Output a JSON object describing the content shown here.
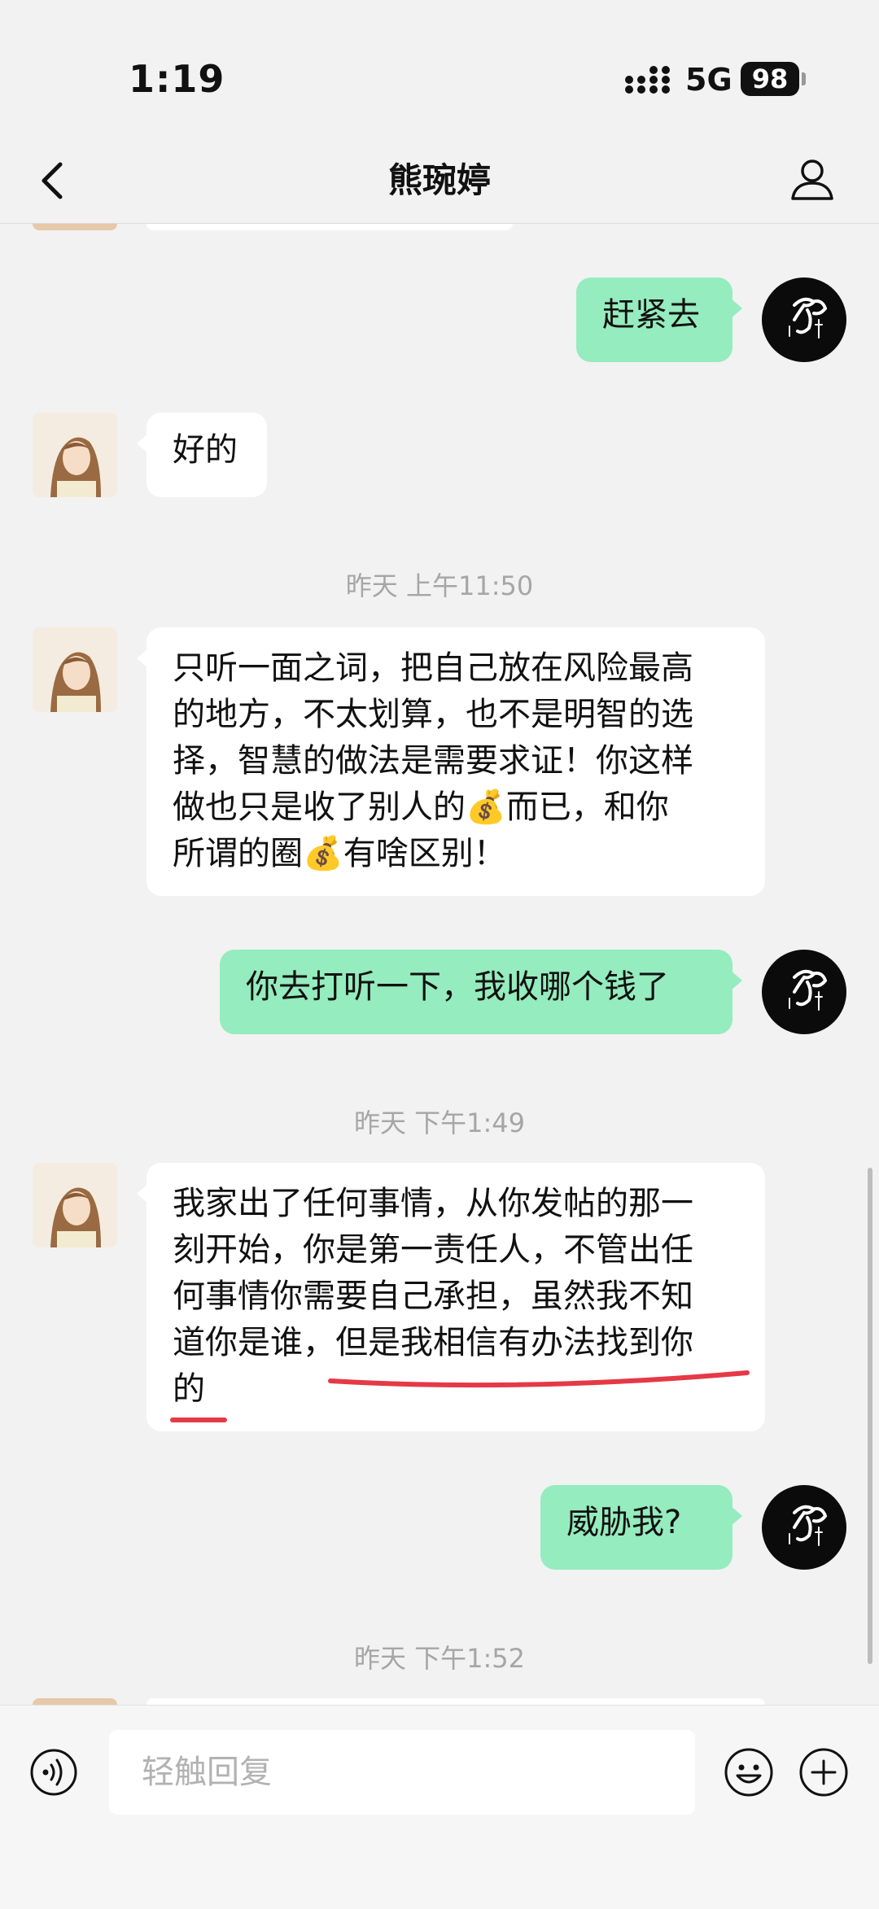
{
  "status_bar": {
    "time": "1:19",
    "network": "5G",
    "battery": "98"
  },
  "header": {
    "title": "熊琬婷"
  },
  "messages": [
    {
      "from": "me",
      "text": "赶紧去"
    },
    {
      "from": "them",
      "text": "好的"
    },
    {
      "timestamp": "昨天 上午11:50"
    },
    {
      "from": "them",
      "lines": [
        "只听一面之词，把自己放在风险最高",
        "的地方，不太划算，也不是明智的选",
        "择，智慧的做法是需要求证！你这样",
        "做也只是收了别人的💰而已，和你",
        "所谓的圈💰有啥区别！"
      ]
    },
    {
      "from": "me",
      "text": "你去打听一下，我收哪个钱了"
    },
    {
      "timestamp": "昨天 下午1:49"
    },
    {
      "from": "them",
      "lines": [
        "我家出了任何事情，从你发帖的那一",
        "刻开始，你是第一责任人，不管出任",
        "何事情你需要自己承担，虽然我不知",
        "道你是谁，但是我相信有办法找到你",
        "的"
      ]
    },
    {
      "from": "me",
      "text": "威胁我?"
    },
    {
      "timestamp": "昨天 下午1:52"
    }
  ],
  "input": {
    "placeholder": "轻触回复"
  },
  "colors": {
    "background": "#f2f2f2",
    "outgoing_bubble": "#95ecbe",
    "incoming_bubble": "#ffffff",
    "annotation": "#e53946"
  },
  "icons": {
    "back": "chevron-left-icon",
    "profile": "user-icon",
    "voice": "voice-icon",
    "emoji": "smile-icon",
    "more": "plus-icon"
  }
}
